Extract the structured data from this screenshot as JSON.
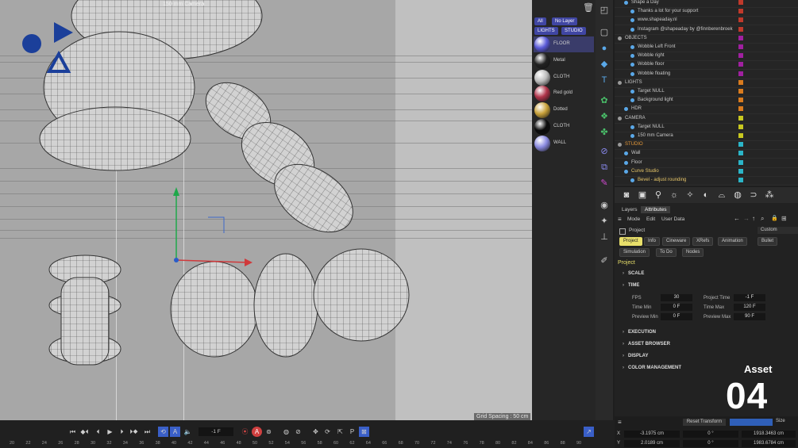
{
  "viewport": {
    "camera_label": "150 mm Camera",
    "grid_spacing": "Grid Spacing : 50 cm"
  },
  "material_manager": {
    "filter_buttons": [
      "All",
      "No Layer",
      "LIGHTS",
      "STUDIO"
    ],
    "materials": [
      {
        "name": "FLOOR",
        "color": "#5a5ad8",
        "selected": true
      },
      {
        "name": "Metal",
        "color": "#222222",
        "selected": false
      },
      {
        "name": "CLOTH",
        "color": "#bdbdbd",
        "selected": false
      },
      {
        "name": "Red gold",
        "color": "#b0344a",
        "selected": false
      },
      {
        "name": "Dotted",
        "color": "#c9a23a",
        "selected": false
      },
      {
        "name": "CLOTH",
        "color": "#0c0c0c",
        "selected": false
      },
      {
        "name": "WALL",
        "color": "#8a8ae0",
        "selected": false
      }
    ]
  },
  "object_manager": {
    "rows": [
      {
        "name": "Shape a Day",
        "indent": 1,
        "color": "#c0392b"
      },
      {
        "name": "Thanks a lot  for your support",
        "indent": 2,
        "color": "#c0392b"
      },
      {
        "name": "www.shapeaday.nl",
        "indent": 2,
        "color": "#c0392b"
      },
      {
        "name": "Instagram @shapeaday by @finnberenbroek",
        "indent": 2,
        "color": "#c0392b"
      },
      {
        "name": "OBJECTS",
        "indent": 0,
        "color": "#a020a0"
      },
      {
        "name": "Wobble Left Front",
        "indent": 2,
        "color": "#a020a0"
      },
      {
        "name": "Wobble right",
        "indent": 2,
        "color": "#a020a0"
      },
      {
        "name": "Wobble floor",
        "indent": 2,
        "color": "#a020a0"
      },
      {
        "name": "Wobble floating",
        "indent": 2,
        "color": "#a020a0"
      },
      {
        "name": "LIGHTS",
        "indent": 0,
        "color": "#d97b1e"
      },
      {
        "name": "Target NULL",
        "indent": 2,
        "color": "#d97b1e"
      },
      {
        "name": "Background light",
        "indent": 2,
        "color": "#d97b1e"
      },
      {
        "name": "HDR",
        "indent": 1,
        "color": "#d97b1e"
      },
      {
        "name": "CAMERA",
        "indent": 0,
        "color": "#c8c820"
      },
      {
        "name": "Target NULL",
        "indent": 2,
        "color": "#c8c820"
      },
      {
        "name": "150 mm Camera",
        "indent": 2,
        "color": "#c8c820"
      },
      {
        "name": "STUDIO",
        "indent": 0,
        "color": "#2bb5c8"
      },
      {
        "name": "Wall",
        "indent": 1,
        "color": "#2bb5c8"
      },
      {
        "name": "Floor",
        "indent": 1,
        "color": "#2bb5c8"
      },
      {
        "name": "Curve Studio",
        "indent": 1,
        "color": "#2bb5c8"
      },
      {
        "name": "Bevel - adjust rounding",
        "indent": 2,
        "color": "#2bb5c8"
      }
    ]
  },
  "attributes": {
    "tabs": [
      "Layers",
      "Attributes"
    ],
    "menu": [
      "Mode",
      "Edit",
      "User Data"
    ],
    "object_name": "Project",
    "preset": "Custom",
    "sub_tabs": [
      "Project",
      "Info",
      "Cineware",
      "XRefs",
      "Animation",
      "Bullet",
      "Simulation",
      "To Do",
      "Nodes"
    ],
    "section_title": "Project",
    "sections": [
      "SCALE",
      "TIME",
      "EXECUTION",
      "ASSET BROWSER",
      "DISPLAY",
      "COLOR MANAGEMENT"
    ],
    "time_fields": {
      "fps_label": "FPS",
      "fps": "30",
      "project_time_label": "Project Time",
      "project_time": "-1 F",
      "time_min_label": "Time Min",
      "time_min": "0 F",
      "time_max_label": "Time Max",
      "time_max": "120 F",
      "preview_min_label": "Preview Min",
      "preview_min": "0 F",
      "preview_max_label": "Preview Max",
      "preview_max": "90 F"
    }
  },
  "asset_badge": {
    "label": "Asset",
    "number": "04"
  },
  "coordinates": {
    "reset_label": "Reset Transform",
    "size_label": "Size",
    "x_label": "X",
    "x_pos": "-3.1975 cm",
    "x_rot": "0 °",
    "x_size": "1918.3463 cm",
    "y_label": "Y",
    "y_pos": "2.0189 cm",
    "y_rot": "0 °",
    "y_size": "1983.6784 cm"
  },
  "timeline": {
    "current_frame": "-1 F",
    "ticks": [
      "20",
      "22",
      "24",
      "26",
      "28",
      "30",
      "32",
      "34",
      "36",
      "38",
      "40",
      "42",
      "44",
      "46",
      "48",
      "50",
      "52",
      "54",
      "56",
      "58",
      "60",
      "62",
      "64",
      "66",
      "68",
      "70",
      "72",
      "74",
      "76",
      "78",
      "80",
      "82",
      "84",
      "86",
      "88",
      "90"
    ]
  }
}
